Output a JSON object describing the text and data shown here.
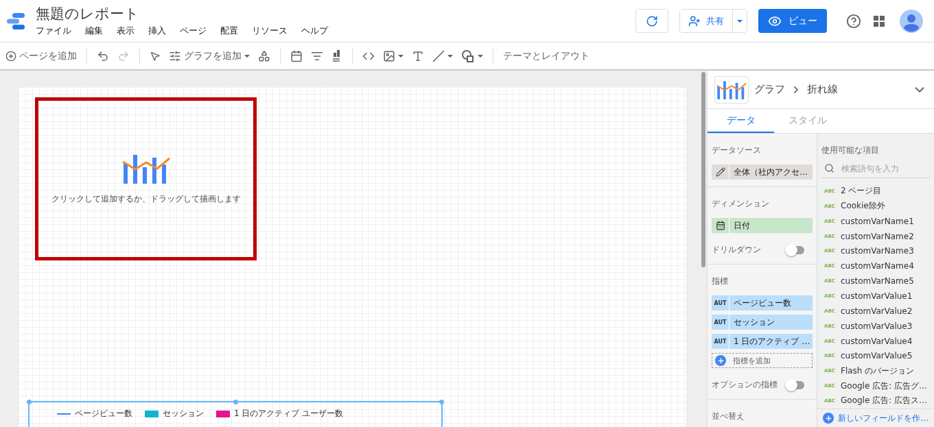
{
  "header": {
    "title": "無題のレポート",
    "menu": [
      "ファイル",
      "編集",
      "表示",
      "挿入",
      "ページ",
      "配置",
      "リソース",
      "ヘルプ"
    ],
    "share": "共有",
    "view": "ビュー"
  },
  "toolbar": {
    "add_page": "ページを追加",
    "add_chart": "グラフを追加",
    "theme": "テーマとレイアウト"
  },
  "canvas": {
    "placeholder_hint": "クリックして追加するか、ドラッグして描画します",
    "legend": [
      {
        "label": "ページビュー数",
        "kind": "line",
        "color": "#4285f4"
      },
      {
        "label": "セッション",
        "kind": "swatch",
        "color": "#12b5cb"
      },
      {
        "label": "1 日のアクティブ ユーザー数",
        "kind": "swatch",
        "color": "#e8128c"
      }
    ]
  },
  "panel": {
    "chart_type": "グラフ",
    "chart_subtype": "折れ線",
    "tabs": [
      {
        "label": "データ",
        "selected": true
      },
      {
        "label": "スタイル",
        "selected": false
      }
    ],
    "data_source": {
      "heading": "データソース",
      "value": "全体（社内アクセ…"
    },
    "dimension": {
      "heading": "ディメンション",
      "value": "日付"
    },
    "drilldown": {
      "label": "ドリルダウン",
      "on": false
    },
    "metrics": {
      "heading": "指標",
      "items": [
        {
          "type": "AUT",
          "label": "ページビュー数"
        },
        {
          "type": "AUT",
          "label": "セッション"
        },
        {
          "type": "AUT",
          "label": "1 日のアクティブ …"
        }
      ],
      "add": "指標を追加"
    },
    "optional_metrics": {
      "label": "オプションの指標",
      "on": false
    },
    "sort": {
      "heading": "並べ替え"
    },
    "fields": {
      "heading": "使用可能な項目",
      "placeholder": "検索語句を入力",
      "items": [
        {
          "type": "ABC",
          "label": "2 ページ目"
        },
        {
          "type": "ABC",
          "label": "Cookie除外"
        },
        {
          "type": "ABC",
          "label": "customVarName1"
        },
        {
          "type": "ABC",
          "label": "customVarName2"
        },
        {
          "type": "ABC",
          "label": "customVarName3"
        },
        {
          "type": "ABC",
          "label": "customVarName4"
        },
        {
          "type": "ABC",
          "label": "customVarName5"
        },
        {
          "type": "ABC",
          "label": "customVarValue1"
        },
        {
          "type": "ABC",
          "label": "customVarValue2"
        },
        {
          "type": "ABC",
          "label": "customVarValue3"
        },
        {
          "type": "ABC",
          "label": "customVarValue4"
        },
        {
          "type": "ABC",
          "label": "customVarValue5"
        },
        {
          "type": "ABC",
          "label": "Flash のバージョン"
        },
        {
          "type": "ABC",
          "label": "Google 広告: 広告グ…"
        },
        {
          "type": "ABC",
          "label": "Google 広告: 広告ス…"
        }
      ],
      "create": "新しいフィールドを作…"
    }
  }
}
